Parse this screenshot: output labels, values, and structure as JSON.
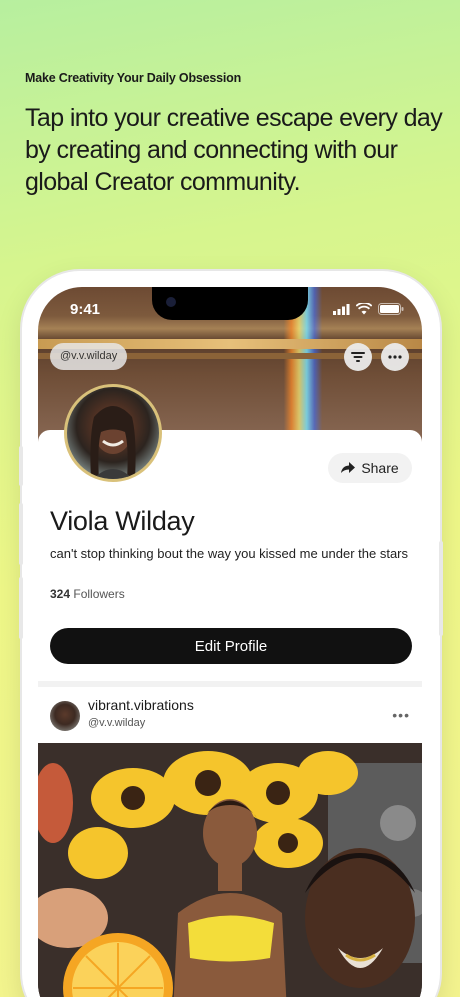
{
  "header": {
    "eyebrow": "Make Creativity Your Daily Obsession",
    "headline": "Tap into your creative escape every day by creating and connecting with  our global Creator community."
  },
  "status_bar": {
    "time": "9:41"
  },
  "profile": {
    "handle": "@v.v.wilday",
    "name": "Viola Wilday",
    "bio": "can't stop thinking bout the way you kissed me under the stars",
    "followers_count": "324",
    "followers_label": "Followers",
    "share_label": "Share",
    "edit_label": "Edit Profile"
  },
  "post": {
    "username": "vibrant.vibrations",
    "handle": "@v.v.wilday",
    "more_label": "•••"
  },
  "icons": [
    "signal-icon",
    "wifi-icon",
    "battery-icon",
    "filter-icon",
    "more-icon",
    "share-arrow-icon"
  ],
  "colors": {
    "accent_bg_top": "#b7ef9f",
    "accent_bg_bottom": "#f4f48f",
    "button_dark": "#111111",
    "avatar_ring": "#d9c17a"
  }
}
